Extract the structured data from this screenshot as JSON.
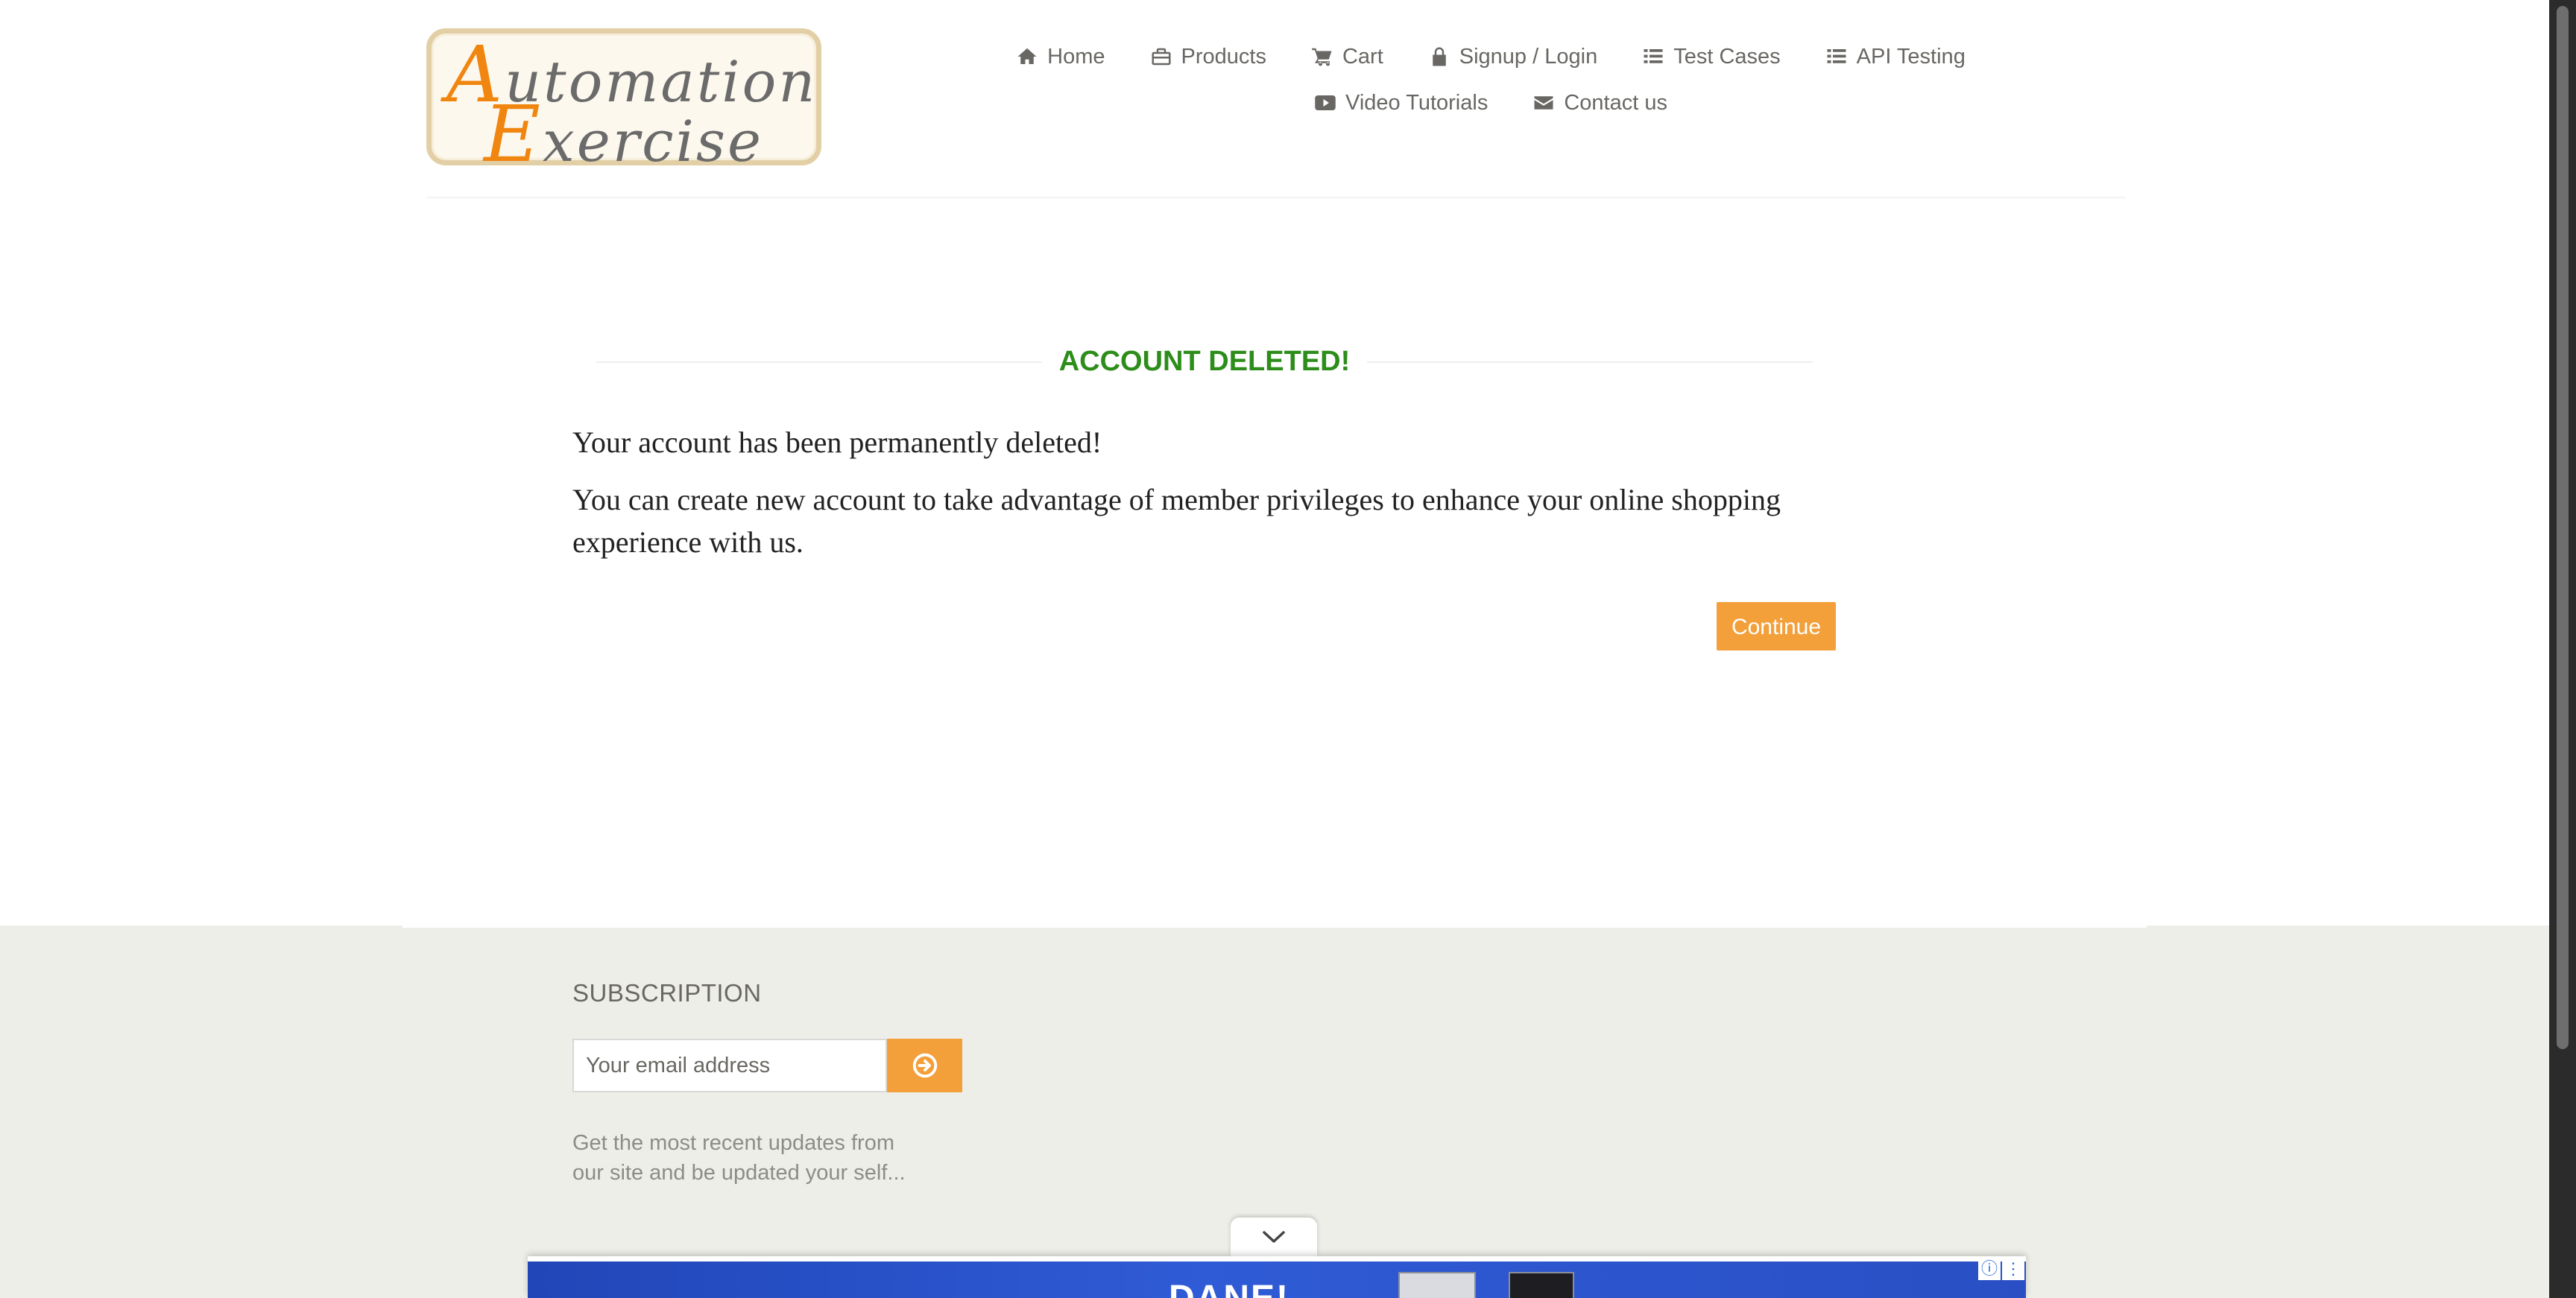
{
  "logo": {
    "line1_cap": "A",
    "line1_rest": "utomation",
    "line2_cap": "E",
    "line2_rest": "xercise"
  },
  "nav": {
    "items": [
      {
        "label": "Home",
        "icon": "home-icon"
      },
      {
        "label": "Products",
        "icon": "briefcase-icon"
      },
      {
        "label": "Cart",
        "icon": "cart-icon"
      },
      {
        "label": "Signup / Login",
        "icon": "lock-icon"
      },
      {
        "label": "Test Cases",
        "icon": "list-icon"
      },
      {
        "label": "API Testing",
        "icon": "list-icon"
      },
      {
        "label": "Video Tutorials",
        "icon": "youtube-play-icon"
      },
      {
        "label": "Contact us",
        "icon": "envelope-icon"
      }
    ]
  },
  "main": {
    "title": "ACCOUNT DELETED!",
    "message1": "Your account has been permanently deleted!",
    "message2": "You can create new account to take advantage of member privileges to enhance your online shopping experience with us.",
    "continue_label": "Continue"
  },
  "footer": {
    "subscription_title": "SUBSCRIPTION",
    "email_placeholder": "Your email address",
    "description": "Get the most recent updates from our site and be updated your self..."
  },
  "ad": {
    "text": "DANE!",
    "info_glyph": "ⓘ",
    "menu_glyph": "⋮"
  },
  "colors": {
    "accent": "#f39f3a",
    "title_green": "#2d8d1a",
    "footer_bg": "#eeeee8",
    "nav_text": "#696763"
  }
}
